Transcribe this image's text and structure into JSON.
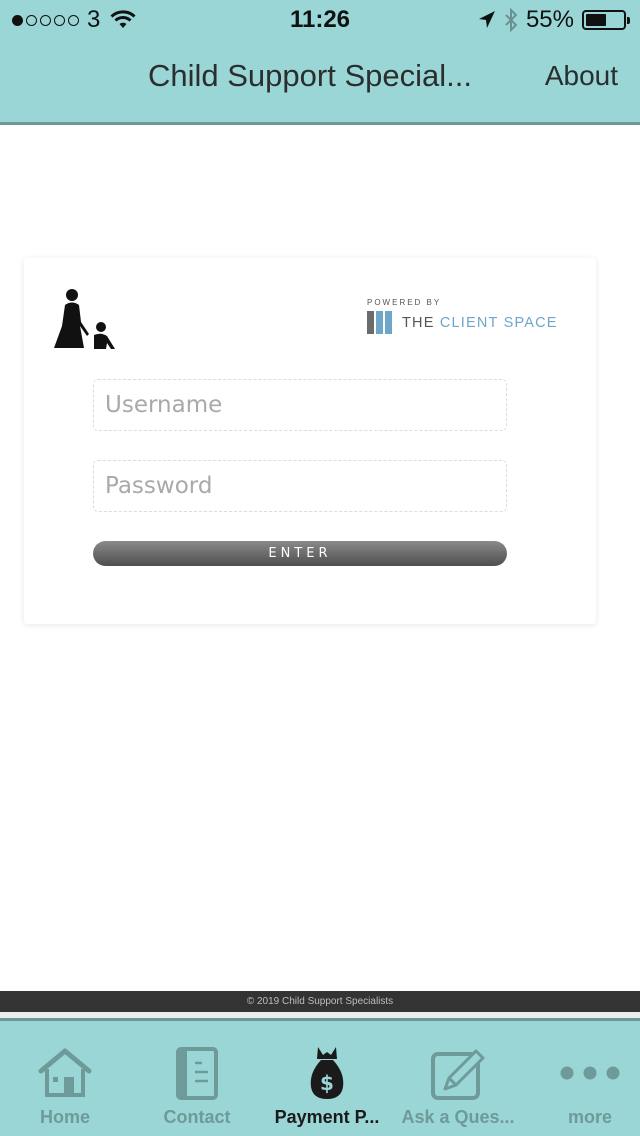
{
  "status_bar": {
    "signal_dots_filled": 1,
    "signal_dots_total": 5,
    "carrier": "3",
    "time": "11:26",
    "battery_percent": "55%",
    "battery_level": 0.55
  },
  "nav": {
    "title": "Child Support Special...",
    "about_label": "About"
  },
  "login_card": {
    "powered_by": "POWERED BY",
    "brand_the": "THE ",
    "brand_client_space": "CLIENT SPACE",
    "brand_colors": [
      "#6b6b6b",
      "#6ea6c9"
    ],
    "username_placeholder": "Username",
    "username_value": "",
    "password_placeholder": "Password",
    "password_value": "",
    "enter_label": "ENTER"
  },
  "footer": {
    "copyright": "© 2019 Child Support Specialists"
  },
  "tab_bar": {
    "items": [
      {
        "label": "Home",
        "icon": "home-icon",
        "active": false
      },
      {
        "label": "Contact",
        "icon": "contact-book-icon",
        "active": false
      },
      {
        "label": "Payment P...",
        "icon": "money-bag-icon",
        "active": true
      },
      {
        "label": "Ask a Ques...",
        "icon": "edit-pencil-icon",
        "active": false
      },
      {
        "label": "more",
        "icon": "more-dots-icon",
        "active": false
      }
    ]
  },
  "colors": {
    "header_bg": "#9bd6d6",
    "header_border": "#6e9896",
    "tab_inactive": "#6e9a9a",
    "tab_active": "#1a1a1a",
    "footer_bg": "#333333"
  }
}
